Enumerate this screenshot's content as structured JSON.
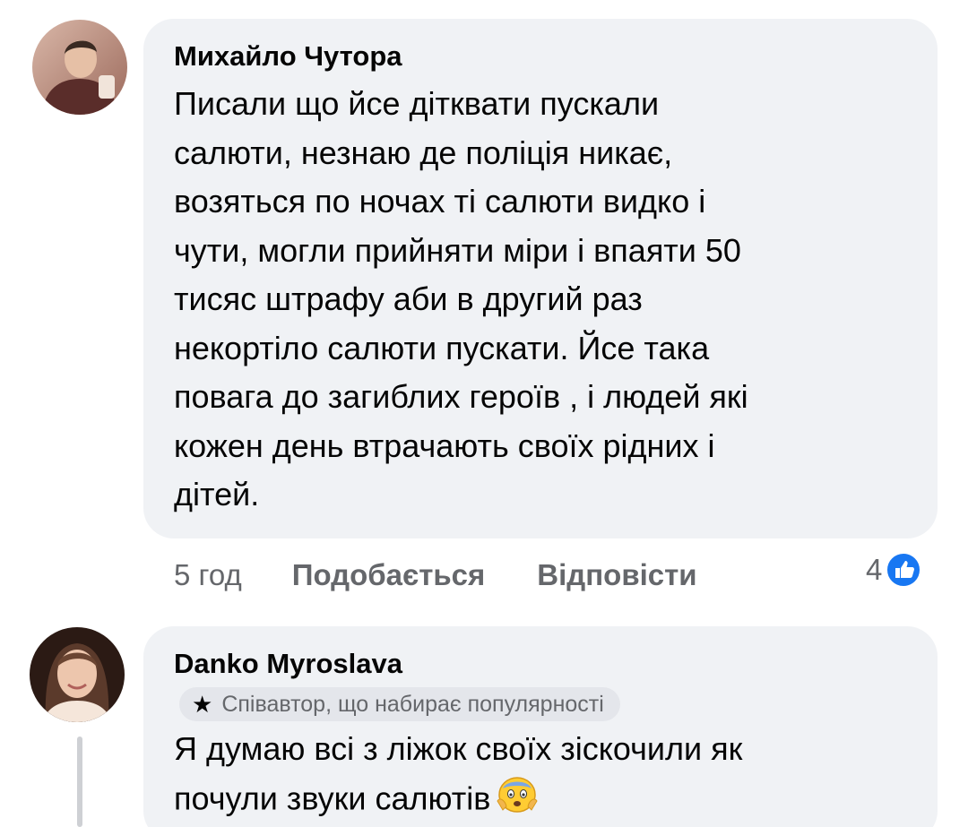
{
  "comments": [
    {
      "author": "Михайло Чутора",
      "avatar_icon": "user-avatar-photo",
      "text_lines": [
        "Писали що йсе дітквати пускали",
        "салюти,  незнаю де поліція никає,",
        "возяться по ночах ті салюти видко і",
        "чути,  могли прийняти міри і впаяти 50",
        "тисяс штрафу аби в другий раз",
        "некортіло салюти пускати.  Йсе така",
        "повага до загиблих героїв , і людей які",
        "кожен день втрачають своїх рідних і",
        "дітей."
      ],
      "time": "5 год",
      "like_label": "Подобається",
      "reply_label": "Відповісти",
      "reaction_count": "4",
      "reaction_icon": "like-thumb-icon"
    },
    {
      "author": "Danko Myroslava",
      "avatar_icon": "user-avatar-photo",
      "badge": "Співавтор, що набирає популярності",
      "badge_icon": "star-icon",
      "text_lines": [
        "Я думаю всі з ліжок своїх зіскочили  як",
        "почули звуки салютів"
      ],
      "emoji_icon": "fearful-face-emoji-icon"
    }
  ],
  "colors": {
    "bubble_bg": "#f0f2f5",
    "text": "#050505",
    "secondary_text": "#65676b",
    "like_blue": "#1877f2",
    "badge_bg": "#e4e6eb"
  }
}
